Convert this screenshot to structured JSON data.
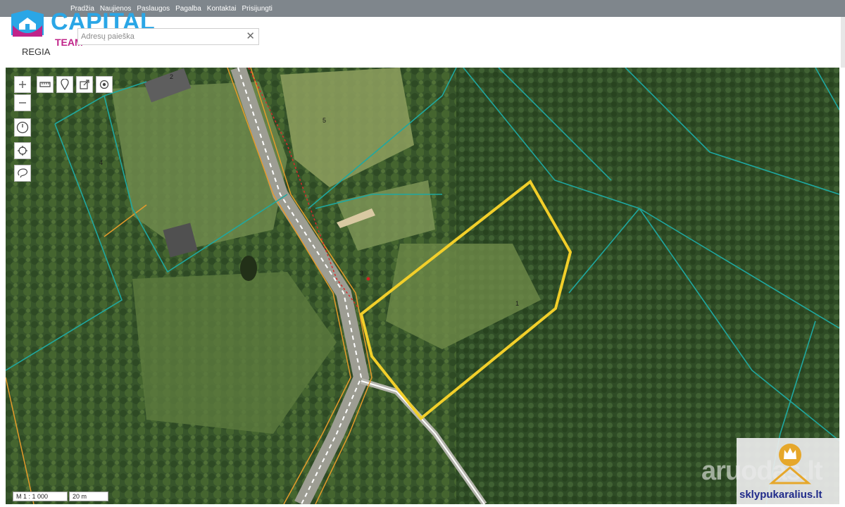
{
  "nav": {
    "items": [
      "Pradžia",
      "Naujienos",
      "Paslaugos",
      "Pagalba",
      "Kontaktai",
      "Prisijungti"
    ]
  },
  "logo": {
    "name": "CAPITAL",
    "sub": "TEAM"
  },
  "search": {
    "placeholder": "Adresų paieška",
    "clear": "✕"
  },
  "region_label": "REGIA",
  "map": {
    "parcel_labels": [
      "1",
      "2",
      "3",
      "4",
      "5"
    ],
    "scale_ratio": "M 1 : 1 000",
    "scale_bar": "20 m",
    "colors": {
      "selected_parcel": "#f2cf2a",
      "cadastre_lines": "#1fa8a0",
      "road_lines": "#e59a2a",
      "protection_zone": "#d92b2b"
    }
  },
  "watermark": "aruodas.lt",
  "brand": "sklypukaralius.lt"
}
